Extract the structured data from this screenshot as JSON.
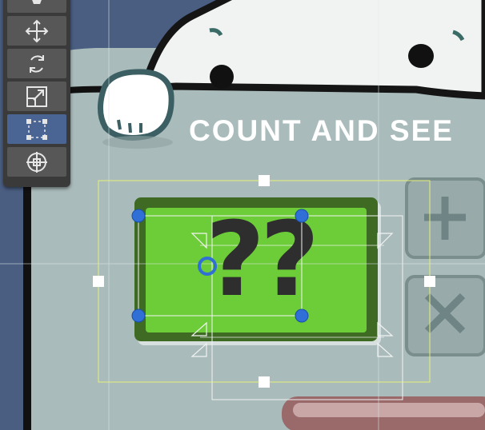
{
  "scene": {
    "title": "COUNT AND SEE",
    "display_value": "??"
  },
  "toolbar": {
    "tools": [
      {
        "name": "view-tool",
        "icon": "hand-icon",
        "active": false
      },
      {
        "name": "move-tool",
        "icon": "move-arrows-icon",
        "active": false
      },
      {
        "name": "rotate-tool",
        "icon": "rotate-icon",
        "active": false
      },
      {
        "name": "scale-tool",
        "icon": "scale-icon",
        "active": false
      },
      {
        "name": "rect-tool",
        "icon": "rect-transform-icon",
        "active": true
      },
      {
        "name": "transform-tool",
        "icon": "transform-gizmo-icon",
        "active": false
      }
    ]
  },
  "colors": {
    "background": "#aabbbb",
    "sky": "#4a5e82",
    "panel_green": "#6ccd38",
    "panel_border": "#3f6a24",
    "title_text": "#ffffff",
    "handle_blue": "#2f6fd6",
    "selection_yellow": "#e6f07a",
    "toolbar_active": "#4a6593"
  }
}
